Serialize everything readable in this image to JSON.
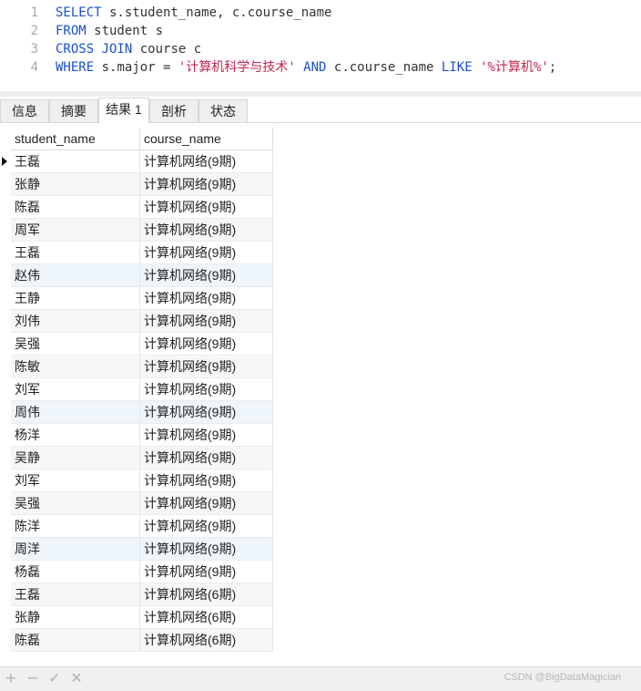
{
  "editor": {
    "lines": [
      {
        "num": "1",
        "tokens": [
          {
            "t": "SELECT",
            "k": "kw"
          },
          {
            "t": " s.student_name, c.course_name",
            "k": "plain"
          }
        ]
      },
      {
        "num": "2",
        "tokens": [
          {
            "t": "FROM",
            "k": "kw"
          },
          {
            "t": " student s",
            "k": "plain"
          }
        ]
      },
      {
        "num": "3",
        "tokens": [
          {
            "t": "CROSS JOIN",
            "k": "kw"
          },
          {
            "t": " course c",
            "k": "plain"
          }
        ]
      },
      {
        "num": "4",
        "tokens": [
          {
            "t": "WHERE",
            "k": "kw"
          },
          {
            "t": " s.major = ",
            "k": "plain"
          },
          {
            "t": "'计算机科学与技术'",
            "k": "str"
          },
          {
            "t": " ",
            "k": "plain"
          },
          {
            "t": "AND",
            "k": "kw"
          },
          {
            "t": " c.course_name ",
            "k": "plain"
          },
          {
            "t": "LIKE",
            "k": "kw"
          },
          {
            "t": " ",
            "k": "plain"
          },
          {
            "t": "'%计算机%'",
            "k": "str"
          },
          {
            "t": ";",
            "k": "plain"
          }
        ]
      }
    ]
  },
  "tabs": [
    {
      "label": "信息",
      "active": false
    },
    {
      "label": "摘要",
      "active": false
    },
    {
      "label": "结果 1",
      "active": true
    },
    {
      "label": "剖析",
      "active": false
    },
    {
      "label": "状态",
      "active": false
    }
  ],
  "grid": {
    "columns": [
      "student_name",
      "course_name"
    ],
    "rows": [
      [
        "王磊",
        "计算机网络(9期)"
      ],
      [
        "张静",
        "计算机网络(9期)"
      ],
      [
        "陈磊",
        "计算机网络(9期)"
      ],
      [
        "周军",
        "计算机网络(9期)"
      ],
      [
        "王磊",
        "计算机网络(9期)"
      ],
      [
        "赵伟",
        "计算机网络(9期)"
      ],
      [
        "王静",
        "计算机网络(9期)"
      ],
      [
        "刘伟",
        "计算机网络(9期)"
      ],
      [
        "吴强",
        "计算机网络(9期)"
      ],
      [
        "陈敏",
        "计算机网络(9期)"
      ],
      [
        "刘军",
        "计算机网络(9期)"
      ],
      [
        "周伟",
        "计算机网络(9期)"
      ],
      [
        "杨洋",
        "计算机网络(9期)"
      ],
      [
        "吴静",
        "计算机网络(9期)"
      ],
      [
        "刘军",
        "计算机网络(9期)"
      ],
      [
        "吴强",
        "计算机网络(9期)"
      ],
      [
        "陈洋",
        "计算机网络(9期)"
      ],
      [
        "周洋",
        "计算机网络(9期)"
      ],
      [
        "杨磊",
        "计算机网络(9期)"
      ],
      [
        "王磊",
        "计算机网络(6期)"
      ],
      [
        "张静",
        "计算机网络(6期)"
      ],
      [
        "陈磊",
        "计算机网络(6期)"
      ]
    ],
    "current_row": 0,
    "highlight_rows": [
      5,
      11,
      17
    ]
  },
  "toolbar": {
    "buttons": [
      {
        "name": "add-row-button",
        "glyph": "+"
      },
      {
        "name": "delete-row-button",
        "glyph": "−"
      },
      {
        "name": "apply-button",
        "glyph": "✓"
      },
      {
        "name": "discard-button",
        "glyph": "✕"
      }
    ],
    "credit": "CSDN @BigDataMagician"
  }
}
